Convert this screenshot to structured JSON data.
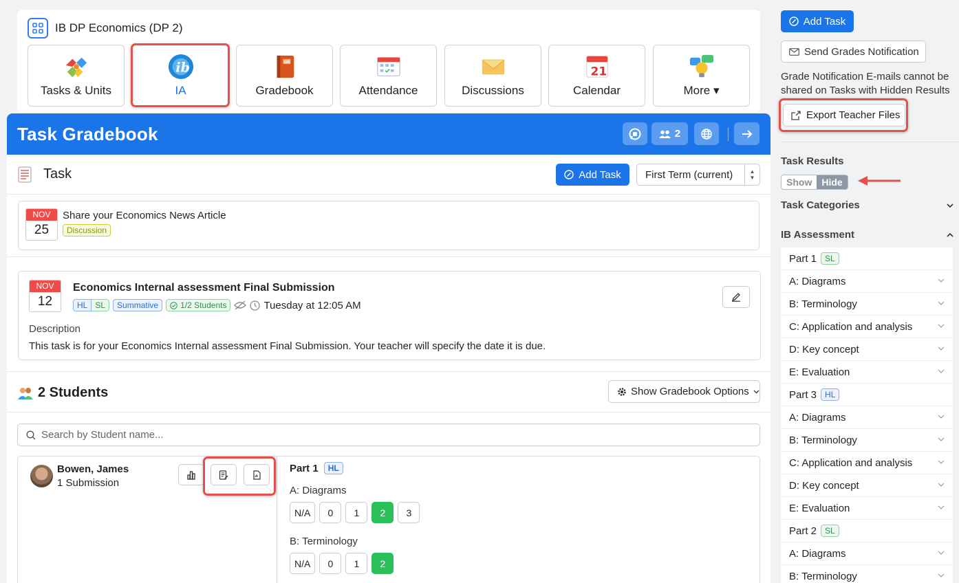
{
  "course": {
    "title": "IB DP Economics (DP 2)",
    "nav": [
      {
        "label": "Tasks & Units",
        "icon": "puzzle-icon"
      },
      {
        "label": "IA",
        "icon": "ib-logo-icon"
      },
      {
        "label": "Gradebook",
        "icon": "gradebook-book-icon"
      },
      {
        "label": "Attendance",
        "icon": "attendance-sheet-icon"
      },
      {
        "label": "Discussions",
        "icon": "envelope-icon"
      },
      {
        "label": "Calendar",
        "icon": "calendar-21-icon"
      },
      {
        "label": "More ▾",
        "icon": "chat-bulb-icon"
      }
    ]
  },
  "gradebook": {
    "title": "Task Gradebook",
    "header_buttons": {
      "members_count": "2"
    },
    "task_heading": "Task",
    "add_task_label": "Add Task",
    "term_select": "First Term (current)",
    "discussion_event": {
      "month": "NOV",
      "day": "25",
      "title": "Share your Economics News Article",
      "tag": "Discussion"
    },
    "task_event": {
      "month": "NOV",
      "day": "12",
      "title": "Economics Internal assessment Final Submission",
      "tags": {
        "hl": "HL",
        "sl": "SL",
        "summative": "Summative",
        "students": "1/2 Students"
      },
      "due": "Tuesday at 12:05 AM",
      "description_label": "Description",
      "description": "This task is for your Economics Internal assessment Final Submission. Your teacher will specify the date it is due."
    },
    "students_heading": "2 Students",
    "options_label": "Show Gradebook Options",
    "search_placeholder": "Search by Student name...",
    "student": {
      "name": "Bowen, James",
      "submissions": "1 Submission",
      "part_title": "Part 1",
      "part_level": "HL",
      "criteria": [
        {
          "label": "A: Diagrams",
          "scores": [
            "N/A",
            "0",
            "1",
            "2",
            "3"
          ],
          "selected": "2"
        },
        {
          "label": "B: Terminology",
          "scores": [
            "N/A",
            "0",
            "1",
            "2"
          ],
          "selected": "2"
        }
      ]
    }
  },
  "sidebar": {
    "add_task_label": "Add Task",
    "send_grades_label": "Send Grades Notification",
    "note": "Grade Notification E-mails cannot be shared on Tasks with Hidden Results",
    "export_label": "Export Teacher Files",
    "task_results_label": "Task Results",
    "toggle_show": "Show",
    "toggle_hide": "Hide",
    "toggle_state": "Hide",
    "task_categories_label": "Task Categories",
    "ib_assessment_label": "IB Assessment",
    "parts": [
      {
        "title": "Part 1",
        "level": "SL",
        "criteria": [
          "A: Diagrams",
          "B: Terminology",
          "C: Application and analysis",
          "D: Key concept",
          "E: Evaluation"
        ]
      },
      {
        "title": "Part 3",
        "level": "HL",
        "criteria": [
          "A: Diagrams",
          "B: Terminology",
          "C: Application and analysis",
          "D: Key concept",
          "E: Evaluation"
        ]
      },
      {
        "title": "Part 2",
        "level": "SL",
        "criteria": [
          "A: Diagrams",
          "B: Terminology"
        ]
      }
    ]
  },
  "colors": {
    "primary": "#1b74e8",
    "highlight": "#e64f4a",
    "selected_score": "#2bc15a",
    "date_badge": "#ef4b4b"
  }
}
